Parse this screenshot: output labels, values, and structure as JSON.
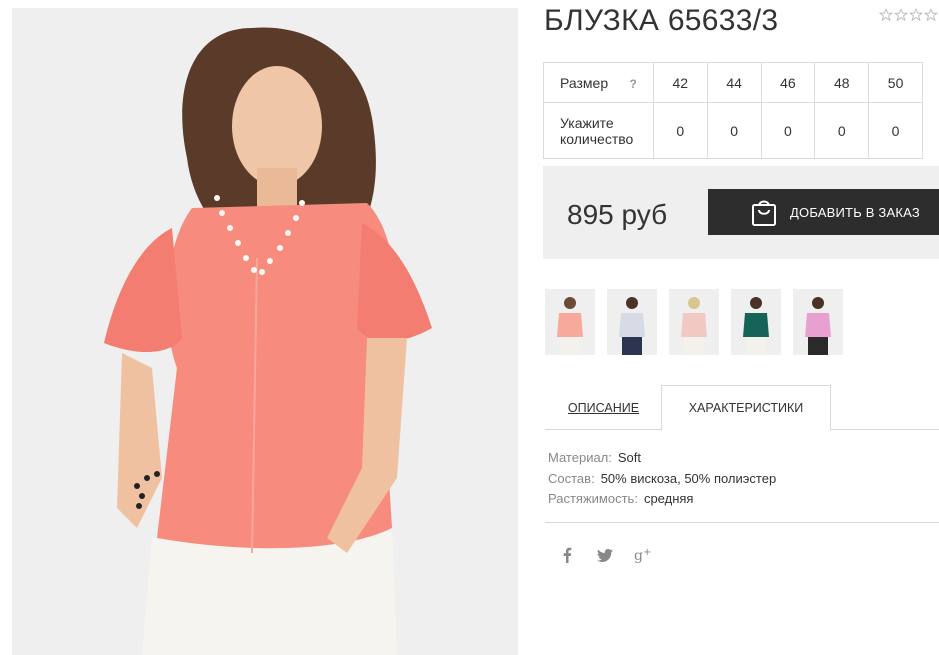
{
  "product": {
    "title": "БЛУЗКА 65633/3",
    "rating_max": 5,
    "rating_value": 0
  },
  "sizes_table": {
    "size_label": "Размер",
    "help": "?",
    "qty_label": "Укажите количество",
    "sizes": [
      "42",
      "44",
      "46",
      "48",
      "50"
    ],
    "quantities": [
      "0",
      "0",
      "0",
      "0",
      "0"
    ]
  },
  "price": {
    "text": "895 руб",
    "add_button": "ДОБАВИТЬ В ЗАКАЗ"
  },
  "thumbnails": [
    {
      "color": "#f7a99b"
    },
    {
      "color": "#d7dbe6"
    },
    {
      "color": "#f2c8c2"
    },
    {
      "color": "#166358"
    },
    {
      "color": "#e8a0d0"
    }
  ],
  "tabs": {
    "description": "ОПИСАНИЕ",
    "characteristics": "ХАРАКТЕРИСТИКИ"
  },
  "specs": [
    {
      "key": "Материал:",
      "value": "Soft"
    },
    {
      "key": "Состав:",
      "value": "50% вискоза, 50% полиэстер"
    },
    {
      "key": "Растяжимость:",
      "value": "средняя"
    }
  ],
  "social": [
    "facebook-icon",
    "twitter-icon",
    "google-plus-icon"
  ],
  "colors": {
    "button_bg": "#2d2d2d",
    "price_bar_bg": "#efefef",
    "blouse": "#f78b7e"
  }
}
